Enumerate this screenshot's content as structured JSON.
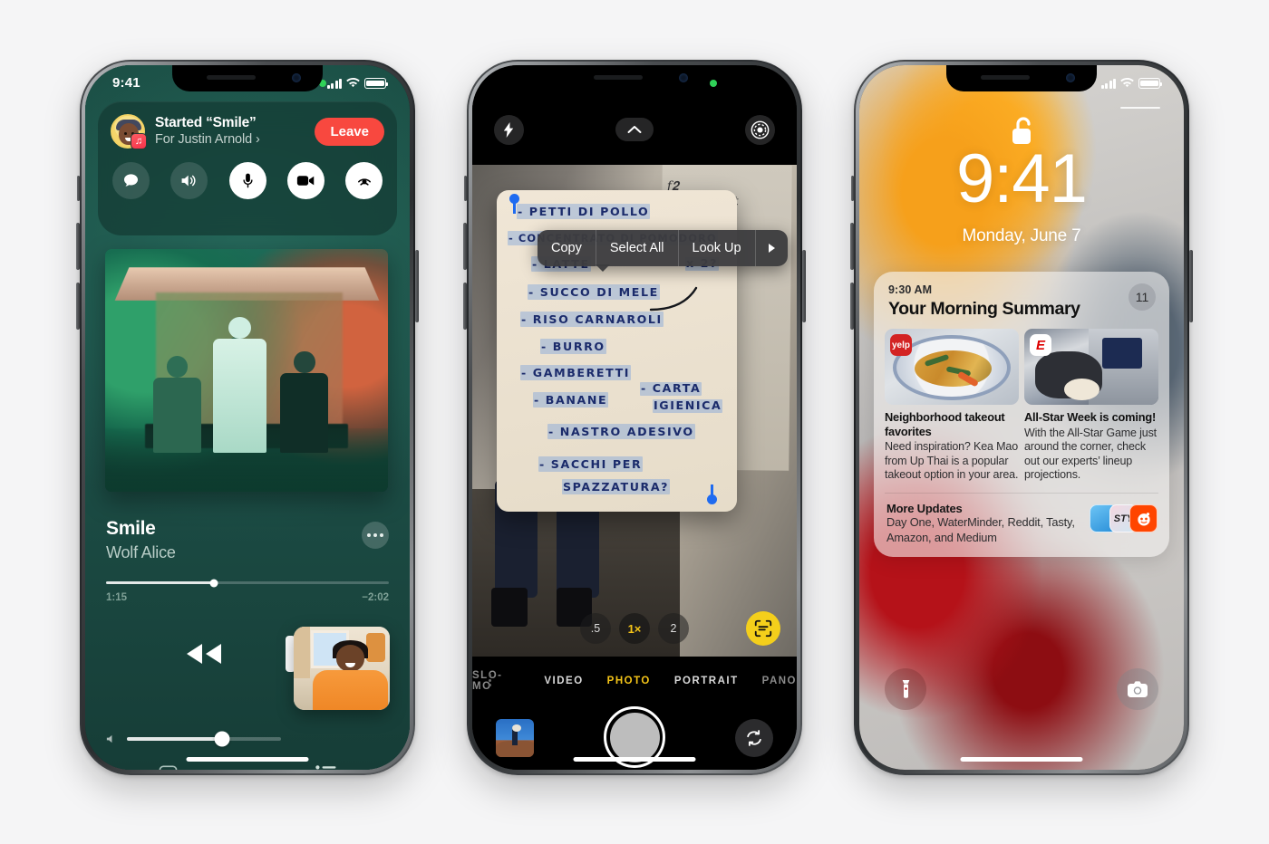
{
  "scene": {
    "background_color": "#f5f5f6",
    "device_count": 3
  },
  "phone1": {
    "name": "iphone-music-shareplay",
    "status_bar": {
      "time": "9:41",
      "recording_indicator": "green-dot"
    },
    "shareplay": {
      "title": "Started “Smile”",
      "subtitle": "For Justin Arnold ›",
      "leave_label": "Leave",
      "avatar_badge_icon": "music-note-icon",
      "controls": [
        {
          "name": "messages-icon",
          "style": "dark"
        },
        {
          "name": "speaker-icon",
          "style": "dark"
        },
        {
          "name": "microphone-icon",
          "style": "light"
        },
        {
          "name": "video-camera-icon",
          "style": "light"
        },
        {
          "name": "shareplay-icon",
          "style": "light"
        }
      ]
    },
    "now_playing": {
      "track": "Smile",
      "artist": "Wolf Alice",
      "elapsed": "1:15",
      "remaining": "−2:02",
      "progress_percent": 38,
      "volume_percent": 62,
      "more_button": "more-options-icon"
    },
    "transport": [
      {
        "name": "rewind-button"
      },
      {
        "name": "pause-button"
      }
    ],
    "bottom_bar": [
      {
        "name": "lyrics-icon"
      },
      {
        "name": "airplay-icon"
      },
      {
        "name": "queue-icon"
      }
    ],
    "pip": {
      "name": "facetime-pip",
      "description": "video call participant"
    }
  },
  "phone2": {
    "name": "iphone-camera-live-text",
    "status_bar": {
      "recording_indicator": "green-dot"
    },
    "top_controls": [
      {
        "name": "flash-icon"
      },
      {
        "name": "chevron-up-icon"
      },
      {
        "name": "live-photo-icon"
      }
    ],
    "context_menu": {
      "items": [
        "Copy",
        "Select All",
        "Look Up"
      ],
      "overflow_icon": "chevron-right-icon"
    },
    "note": {
      "lines": [
        {
          "text": "- PETTI DI POLLO",
          "indent": 10,
          "highlighted": true
        },
        {
          "text": "- CONCENTRATO DI POMODORO",
          "indent": 0,
          "highlighted": true
        },
        {
          "text": "- LATTE",
          "indent": 26,
          "highlighted": true
        },
        {
          "text": "- SUCCO DI MELE",
          "indent": 22,
          "highlighted": true
        },
        {
          "text": "- RISO CARNAROLI",
          "indent": 14,
          "highlighted": true
        },
        {
          "text": "- BURRO",
          "indent": 36,
          "highlighted": true
        },
        {
          "text": "- GAMBERETTI",
          "indent": 14,
          "highlighted": true
        },
        {
          "text": "- BANANE",
          "indent": 28,
          "highlighted": true
        },
        {
          "text": "- NASTRO ADESIVO",
          "indent": 44,
          "highlighted": true
        },
        {
          "text": "- SACCHI PER",
          "indent": 34,
          "highlighted": true
        },
        {
          "text": "SPAZZATURA?",
          "indent": 60,
          "highlighted": true
        }
      ],
      "annotations": [
        {
          "text": "x 2?",
          "highlighted": true
        },
        {
          "text": "- CARTA",
          "highlighted": true
        },
        {
          "text": "IGIENICA",
          "highlighted": true
        }
      ]
    },
    "zoom_levels": [
      {
        "label": ".5",
        "active": false
      },
      {
        "label": "1×",
        "active": true
      },
      {
        "label": "2",
        "active": false
      }
    ],
    "live_text_button": "live-text-icon",
    "modes": [
      {
        "label": "SLO-MO",
        "active": false
      },
      {
        "label": "VIDEO",
        "active": false
      },
      {
        "label": "PHOTO",
        "active": true
      },
      {
        "label": "PORTRAIT",
        "active": false
      },
      {
        "label": "PANO",
        "active": false
      }
    ],
    "bottom": {
      "thumbnail": "photo-library-thumbnail",
      "shutter": "shutter-button",
      "flip": "flip-camera-icon"
    },
    "accent_color": "#f5c518"
  },
  "phone3": {
    "name": "iphone-lock-screen-notification-summary",
    "status_bar": {},
    "lock_icon": "unlocked-padlock-icon",
    "time": "9:41",
    "date": "Monday, June 7",
    "summary": {
      "time": "9:30 AM",
      "title": "Your Morning Summary",
      "count": "11",
      "cards": [
        {
          "app_icon": "yelp-icon",
          "title": "Neighborhood takeout favorites",
          "body": "Need inspiration? Kea Mao from Up Thai is a popular takeout option in your area."
        },
        {
          "app_icon": "espn-icon",
          "title": "All-Star Week is coming!",
          "body": "With the All-Star Game just around the corner, check out our experts’ lineup projections."
        }
      ],
      "more": {
        "title": "More Updates",
        "body": "Day One, WaterMinder, Reddit, Tasty, Amazon, and Medium",
        "icons": [
          "reddit-icon",
          "tasty-icon",
          "day-one-icon"
        ]
      }
    },
    "bottom_buttons": [
      {
        "name": "flashlight-icon"
      },
      {
        "name": "camera-icon"
      }
    ]
  }
}
